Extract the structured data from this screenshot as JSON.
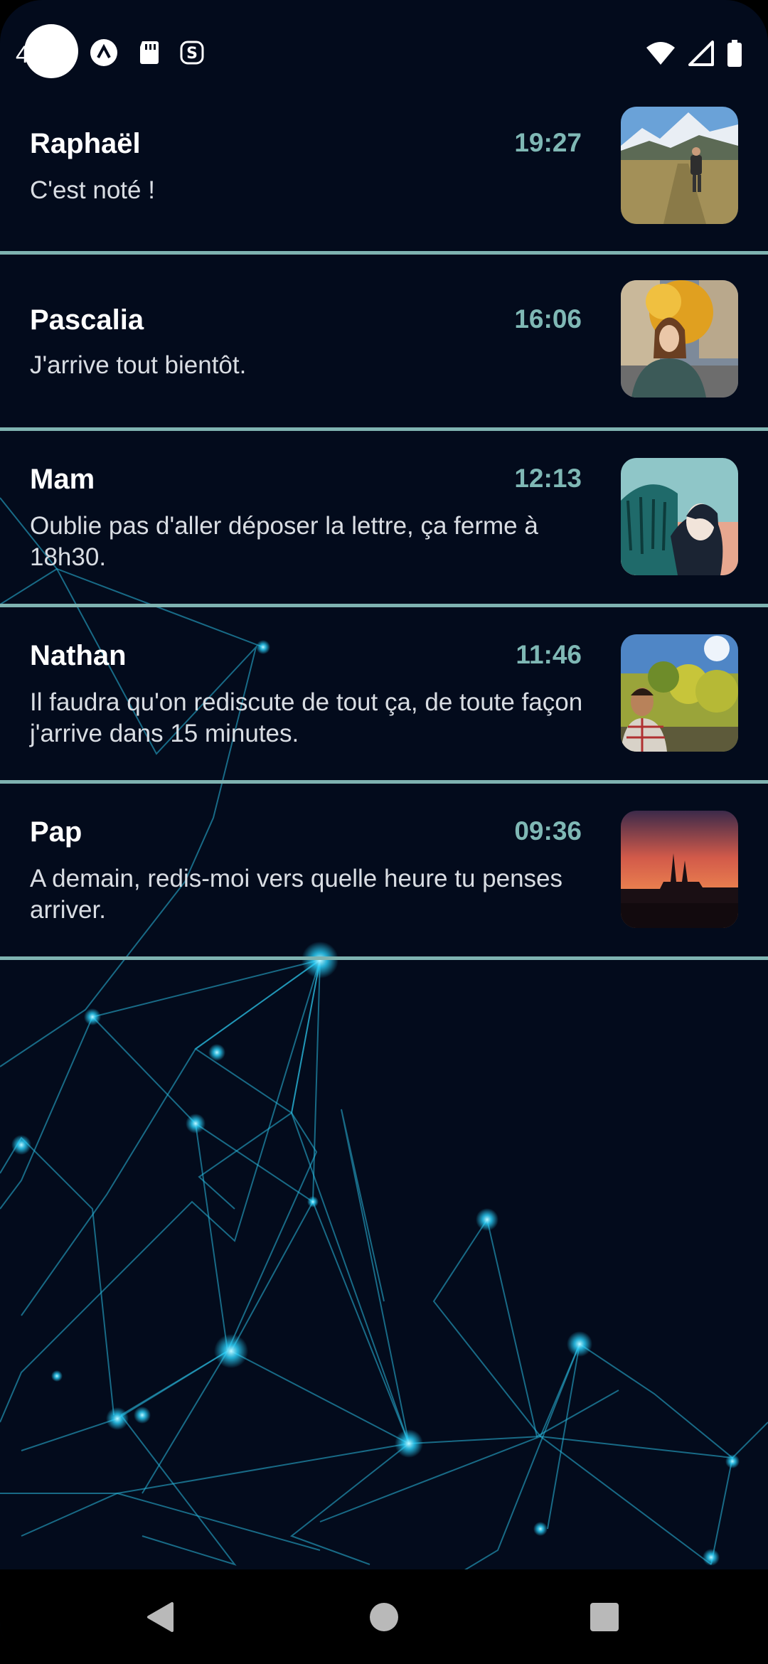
{
  "status_bar": {
    "clock": "4",
    "icons": [
      "app-a-icon",
      "sd-card-icon",
      "app-s-icon",
      "wifi-icon",
      "signal-icon",
      "battery-icon"
    ]
  },
  "messages": [
    {
      "sender": "Raphaël",
      "time": "19:27",
      "preview": "C'est noté !",
      "thumbnail": "mountain-hiker-photo"
    },
    {
      "sender": "Pascalia",
      "time": "16:06",
      "preview": "J'arrive tout bientôt.",
      "thumbnail": "woman-autumn-street-photo"
    },
    {
      "sender": "Mam",
      "time": "12:13",
      "preview": "Oublie pas d'aller déposer la lettre, ça ferme à 18h30.",
      "thumbnail": "illustration-woman-tree-photo"
    },
    {
      "sender": "Nathan",
      "time": "11:46",
      "preview": "Il faudra qu'on rediscute de tout ça, de toute façon j'arrive dans 15 minutes.",
      "thumbnail": "man-vineyard-photo"
    },
    {
      "sender": "Pap",
      "time": "09:36",
      "preview": "A demain, redis-moi vers quelle heure tu penses arriver.",
      "thumbnail": "sunset-cathedral-photo"
    }
  ],
  "nav_bar": {
    "buttons": [
      "back-icon",
      "home-icon",
      "recents-icon"
    ]
  },
  "colors": {
    "background": "#030b1c",
    "divider": "#7fb3b1",
    "time_accent": "#7fb8b5",
    "network_glow": "#2ad4ff"
  }
}
